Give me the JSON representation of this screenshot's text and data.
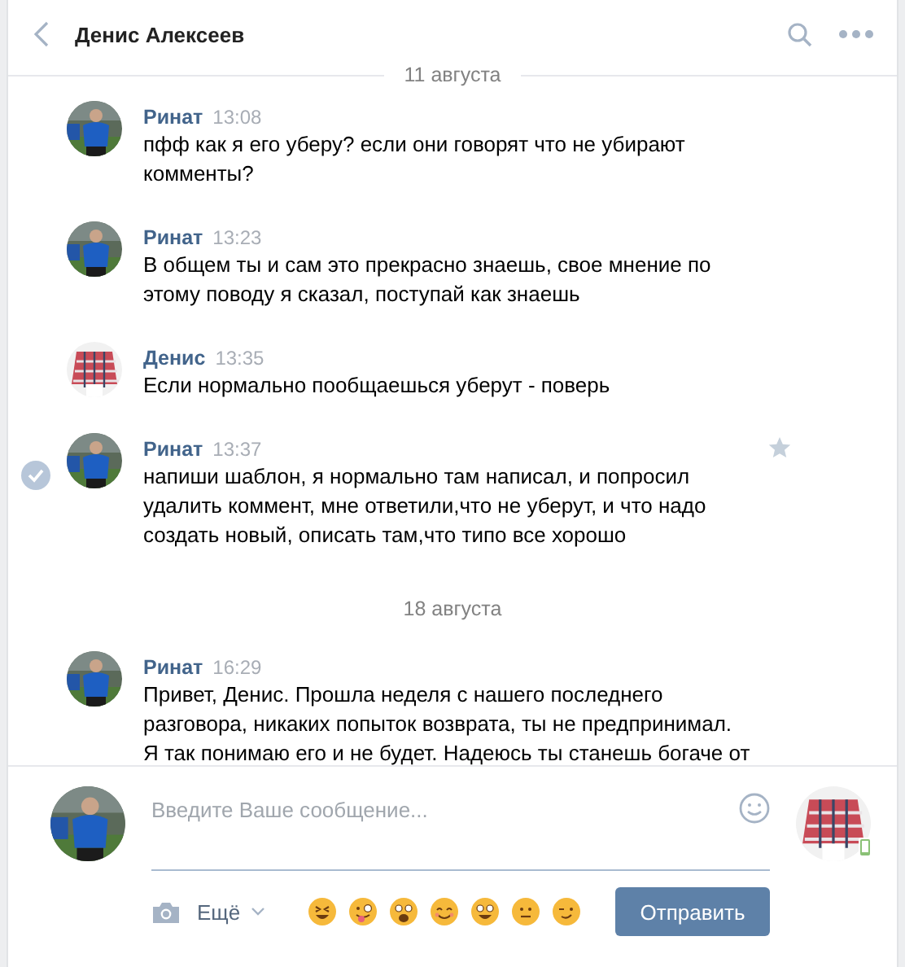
{
  "header": {
    "title": "Денис Алексеев"
  },
  "messages": [
    {
      "kind": "date",
      "text": "11 августа"
    },
    {
      "kind": "message",
      "author": "Ринат",
      "time": "13:08",
      "outgoing": true,
      "selected": false,
      "text": "пфф как я его уберу? если они говорят что не убирают комменты?"
    },
    {
      "kind": "message",
      "author": "Ринат",
      "time": "13:23",
      "outgoing": true,
      "selected": false,
      "text": "В общем ты и сам это прекрасно знаешь, свое мнение по этому поводу я сказал, поступай как знаешь"
    },
    {
      "kind": "message",
      "author": "Денис",
      "time": "13:35",
      "outgoing": false,
      "selected": false,
      "text": "Если нормально пообщаешься уберут - поверь"
    },
    {
      "kind": "message",
      "author": "Ринат",
      "time": "13:37",
      "outgoing": true,
      "selected": true,
      "text": "напиши шаблон, я нормально там написал, и попросил удалить коммент, мне ответили,что не уберут, и что надо создать новый, описать там,что типо все хорошо"
    },
    {
      "kind": "date",
      "text": "18 августа"
    },
    {
      "kind": "message",
      "author": "Ринат",
      "time": "16:29",
      "outgoing": true,
      "selected": false,
      "text": "Привет, Денис. Прошла неделя с нашего последнего разговора, никаких попыток возврата, ты не предпринимал. Я так понимаю его и не будет. Надеюсь ты станешь богаче от"
    }
  ],
  "composer": {
    "placeholder": "Введите Ваше сообщение...",
    "more_label": "Ещё",
    "send_label": "Отправить",
    "peer_online_mobile": true,
    "emojis": [
      {
        "kind": "laugh"
      },
      {
        "kind": "tongue"
      },
      {
        "kind": "scream"
      },
      {
        "kind": "smile"
      },
      {
        "kind": "grin"
      },
      {
        "kind": "neutral"
      },
      {
        "kind": "wink"
      }
    ]
  }
}
